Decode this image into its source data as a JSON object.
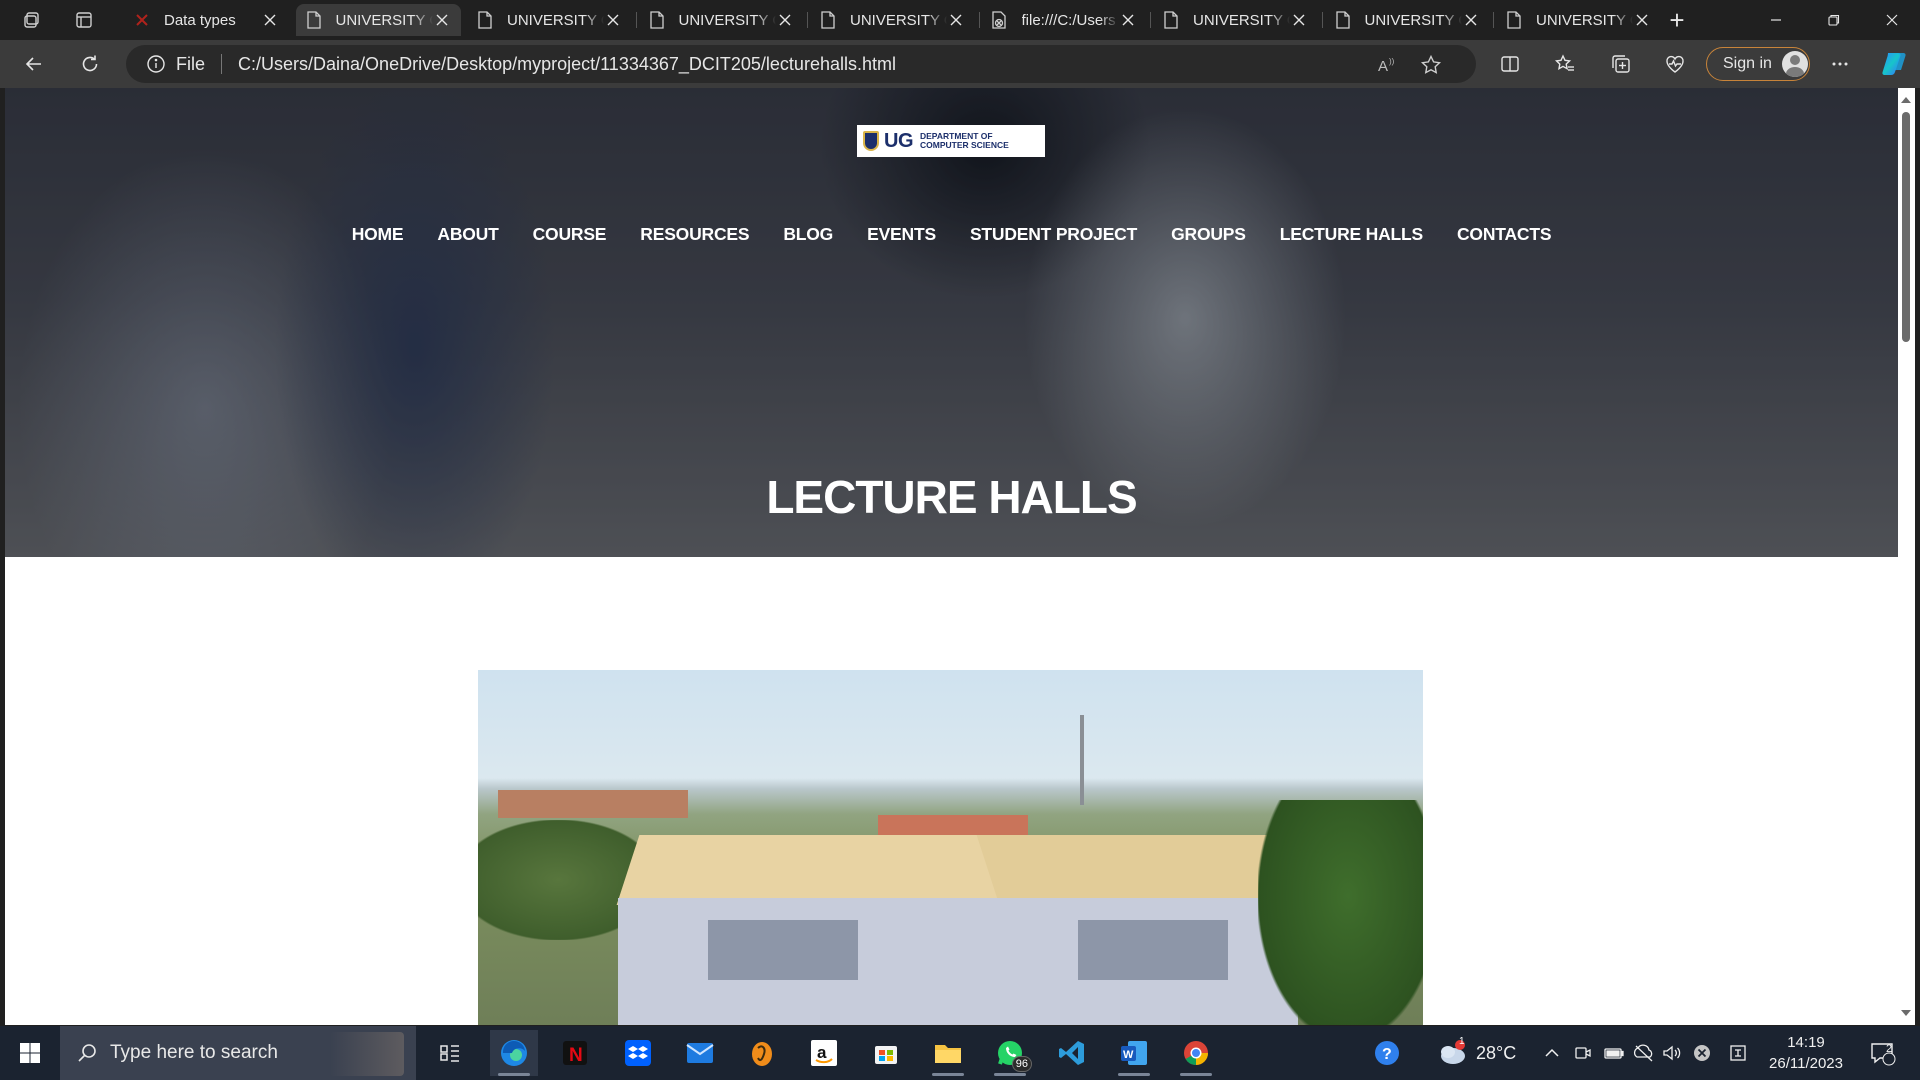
{
  "browser": {
    "tabs": [
      {
        "title": "Data types",
        "icon": "x-brand-icon",
        "active": false
      },
      {
        "title": "UNIVERSITY OF",
        "icon": "file-icon",
        "active": true
      },
      {
        "title": "UNIVERSITY OF",
        "icon": "file-icon",
        "active": false
      },
      {
        "title": "UNIVERSITY OF",
        "icon": "file-icon",
        "active": false
      },
      {
        "title": "UNIVERSITY OF",
        "icon": "file-icon",
        "active": false
      },
      {
        "title": "file:///C:/Users",
        "icon": "file-error-icon",
        "active": false
      },
      {
        "title": "UNIVERSITY OF",
        "icon": "file-icon",
        "active": false
      },
      {
        "title": "UNIVERSITY OF",
        "icon": "file-icon",
        "active": false
      },
      {
        "title": "UNIVERSITY OF",
        "icon": "file-icon",
        "active": false
      }
    ],
    "address": {
      "scheme_label": "File",
      "url": "C:/Users/Daina/OneDrive/Desktop/myproject/11334367_DCIT205/lecturehalls.html"
    },
    "signin_label": "Sign in"
  },
  "page": {
    "logo": {
      "mark": "UG",
      "line1": "DEPARTMENT OF",
      "line2": "COMPUTER SCIENCE"
    },
    "nav": [
      "HOME",
      "ABOUT",
      "COURSE",
      "RESOURCES",
      "BLOG",
      "EVENTS",
      "STUDENT PROJECT",
      "GROUPS",
      "LECTURE HALLS",
      "CONTACTS"
    ],
    "hero_title": "LECTURE HALLS"
  },
  "taskbar": {
    "search_placeholder": "Type here to search",
    "whatsapp_badge": "96",
    "weather_temp": "28°C",
    "weather_alert": "1",
    "time": "14:19",
    "date": "26/11/2023",
    "notifications": "2"
  },
  "colors": {
    "chrome_dark": "#202020",
    "chrome_bar": "#3b3b3b",
    "taskbar": "#1b2330",
    "signin_border": "#c8843a",
    "logo_navy": "#1c2f6b"
  }
}
